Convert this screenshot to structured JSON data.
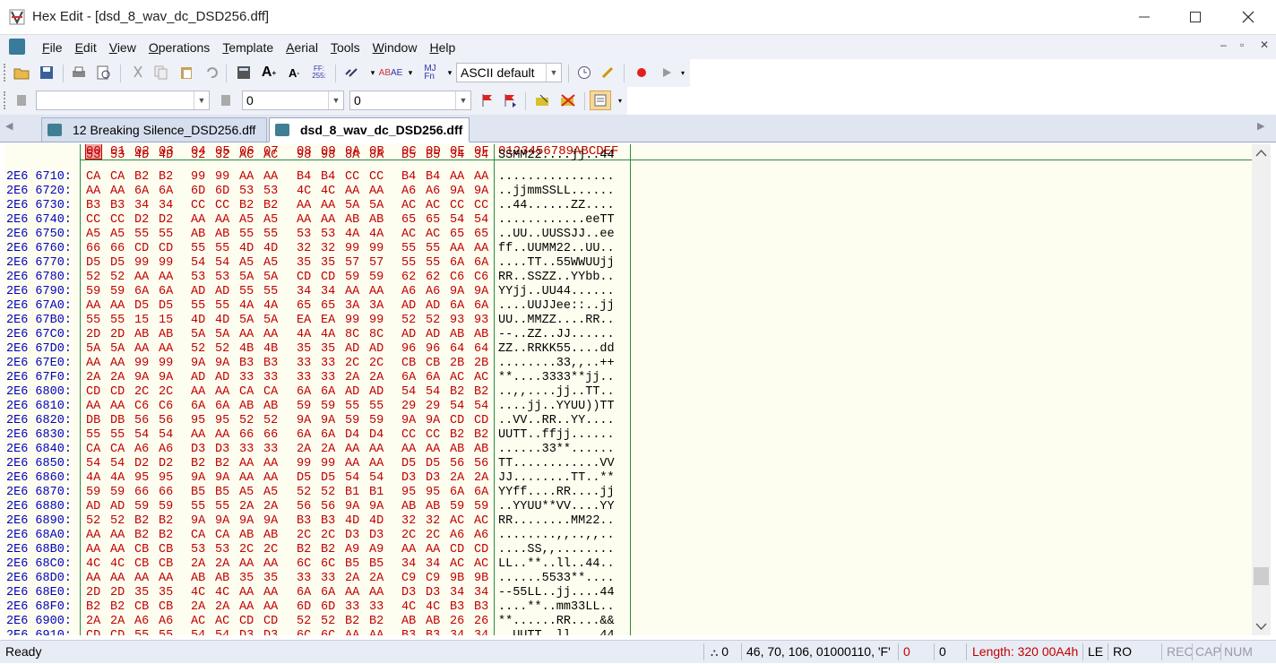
{
  "window": {
    "title": "Hex Edit - [dsd_8_wav_dc_DSD256.dff]"
  },
  "menu": [
    "File",
    "Edit",
    "View",
    "Operations",
    "Template",
    "Aerial",
    "Tools",
    "Window",
    "Help"
  ],
  "toolbar": {
    "charset_combo": "ASCII default"
  },
  "findbar": {
    "search_value": "",
    "field2": "0",
    "field3": "0"
  },
  "tabs": [
    {
      "label": "12 Breaking Silence_DSD256.dff",
      "active": false
    },
    {
      "label": "dsd_8_wav_dc_DSD256.dff",
      "active": true
    }
  ],
  "hex_header": {
    "columns": [
      "00",
      "01",
      "02",
      "03",
      "04",
      "05",
      "06",
      "07",
      "08",
      "09",
      "0A",
      "0B",
      "0C",
      "0D",
      "0E",
      "0F"
    ],
    "ascii_header": "0123456789ABCDEF"
  },
  "partial_top": {
    "hex": [
      "53",
      "53",
      "4D",
      "4D",
      "32",
      "32",
      "AC",
      "AC",
      "98",
      "98",
      "8A",
      "8A",
      "B5",
      "B5",
      "34",
      "34"
    ],
    "ascii": "SSMM22....jj..44"
  },
  "rows": [
    {
      "addr": "2E6 6710:",
      "hex": [
        "CA",
        "CA",
        "B2",
        "B2",
        "99",
        "99",
        "AA",
        "AA",
        "B4",
        "B4",
        "CC",
        "CC",
        "B4",
        "B4",
        "AA",
        "AA"
      ],
      "ascii": "................"
    },
    {
      "addr": "2E6 6720:",
      "hex": [
        "AA",
        "AA",
        "6A",
        "6A",
        "6D",
        "6D",
        "53",
        "53",
        "4C",
        "4C",
        "AA",
        "AA",
        "A6",
        "A6",
        "9A",
        "9A"
      ],
      "ascii": "..jjmmSSLL......"
    },
    {
      "addr": "2E6 6730:",
      "hex": [
        "B3",
        "B3",
        "34",
        "34",
        "CC",
        "CC",
        "B2",
        "B2",
        "AA",
        "AA",
        "5A",
        "5A",
        "AC",
        "AC",
        "CC",
        "CC"
      ],
      "ascii": "..44......ZZ...."
    },
    {
      "addr": "2E6 6740:",
      "hex": [
        "CC",
        "CC",
        "D2",
        "D2",
        "AA",
        "AA",
        "A5",
        "A5",
        "AA",
        "AA",
        "AB",
        "AB",
        "65",
        "65",
        "54",
        "54"
      ],
      "ascii": "............eeTT"
    },
    {
      "addr": "2E6 6750:",
      "hex": [
        "A5",
        "A5",
        "55",
        "55",
        "AB",
        "AB",
        "55",
        "55",
        "53",
        "53",
        "4A",
        "4A",
        "AC",
        "AC",
        "65",
        "65"
      ],
      "ascii": "..UU..UUSSJJ..ee"
    },
    {
      "addr": "2E6 6760:",
      "hex": [
        "66",
        "66",
        "CD",
        "CD",
        "55",
        "55",
        "4D",
        "4D",
        "32",
        "32",
        "99",
        "99",
        "55",
        "55",
        "AA",
        "AA"
      ],
      "ascii": "ff..UUMM22..UU.."
    },
    {
      "addr": "2E6 6770:",
      "hex": [
        "D5",
        "D5",
        "99",
        "99",
        "54",
        "54",
        "A5",
        "A5",
        "35",
        "35",
        "57",
        "57",
        "55",
        "55",
        "6A",
        "6A"
      ],
      "ascii": "....TT..55WWUUjj"
    },
    {
      "addr": "2E6 6780:",
      "hex": [
        "52",
        "52",
        "AA",
        "AA",
        "53",
        "53",
        "5A",
        "5A",
        "CD",
        "CD",
        "59",
        "59",
        "62",
        "62",
        "C6",
        "C6"
      ],
      "ascii": "RR..SSZZ..YYbb.."
    },
    {
      "addr": "2E6 6790:",
      "hex": [
        "59",
        "59",
        "6A",
        "6A",
        "AD",
        "AD",
        "55",
        "55",
        "34",
        "34",
        "AA",
        "AA",
        "A6",
        "A6",
        "9A",
        "9A"
      ],
      "ascii": "YYjj..UU44......"
    },
    {
      "addr": "2E6 67A0:",
      "hex": [
        "AA",
        "AA",
        "D5",
        "D5",
        "55",
        "55",
        "4A",
        "4A",
        "65",
        "65",
        "3A",
        "3A",
        "AD",
        "AD",
        "6A",
        "6A"
      ],
      "ascii": "....UUJJee::..jj"
    },
    {
      "addr": "2E6 67B0:",
      "hex": [
        "55",
        "55",
        "15",
        "15",
        "4D",
        "4D",
        "5A",
        "5A",
        "EA",
        "EA",
        "99",
        "99",
        "52",
        "52",
        "93",
        "93"
      ],
      "ascii": "UU..MMZZ....RR.."
    },
    {
      "addr": "2E6 67C0:",
      "hex": [
        "2D",
        "2D",
        "AB",
        "AB",
        "5A",
        "5A",
        "AA",
        "AA",
        "4A",
        "4A",
        "8C",
        "8C",
        "AD",
        "AD",
        "AB",
        "AB"
      ],
      "ascii": "--..ZZ..JJ......"
    },
    {
      "addr": "2E6 67D0:",
      "hex": [
        "5A",
        "5A",
        "AA",
        "AA",
        "52",
        "52",
        "4B",
        "4B",
        "35",
        "35",
        "AD",
        "AD",
        "96",
        "96",
        "64",
        "64"
      ],
      "ascii": "ZZ..RRKK55....dd"
    },
    {
      "addr": "2E6 67E0:",
      "hex": [
        "AA",
        "AA",
        "99",
        "99",
        "9A",
        "9A",
        "B3",
        "B3",
        "33",
        "33",
        "2C",
        "2C",
        "CB",
        "CB",
        "2B",
        "2B"
      ],
      "ascii": "........33,,..++"
    },
    {
      "addr": "2E6 67F0:",
      "hex": [
        "2A",
        "2A",
        "9A",
        "9A",
        "AD",
        "AD",
        "33",
        "33",
        "33",
        "33",
        "2A",
        "2A",
        "6A",
        "6A",
        "AC",
        "AC"
      ],
      "ascii": "**....3333**jj.."
    },
    {
      "addr": "2E6 6800:",
      "hex": [
        "CD",
        "CD",
        "2C",
        "2C",
        "AA",
        "AA",
        "CA",
        "CA",
        "6A",
        "6A",
        "AD",
        "AD",
        "54",
        "54",
        "B2",
        "B2"
      ],
      "ascii": "..,,....jj..TT.."
    },
    {
      "addr": "2E6 6810:",
      "hex": [
        "AA",
        "AA",
        "C6",
        "C6",
        "6A",
        "6A",
        "AB",
        "AB",
        "59",
        "59",
        "55",
        "55",
        "29",
        "29",
        "54",
        "54"
      ],
      "ascii": "....jj..YYUU))TT"
    },
    {
      "addr": "2E6 6820:",
      "hex": [
        "DB",
        "DB",
        "56",
        "56",
        "95",
        "95",
        "52",
        "52",
        "9A",
        "9A",
        "59",
        "59",
        "9A",
        "9A",
        "CD",
        "CD"
      ],
      "ascii": "..VV..RR..YY...."
    },
    {
      "addr": "2E6 6830:",
      "hex": [
        "55",
        "55",
        "54",
        "54",
        "AA",
        "AA",
        "66",
        "66",
        "6A",
        "6A",
        "D4",
        "D4",
        "CC",
        "CC",
        "B2",
        "B2"
      ],
      "ascii": "UUTT..ffjj......"
    },
    {
      "addr": "2E6 6840:",
      "hex": [
        "CA",
        "CA",
        "A6",
        "A6",
        "D3",
        "D3",
        "33",
        "33",
        "2A",
        "2A",
        "AA",
        "AA",
        "AA",
        "AA",
        "AB",
        "AB"
      ],
      "ascii": "......33**......"
    },
    {
      "addr": "2E6 6850:",
      "hex": [
        "54",
        "54",
        "D2",
        "D2",
        "B2",
        "B2",
        "AA",
        "AA",
        "99",
        "99",
        "AA",
        "AA",
        "D5",
        "D5",
        "56",
        "56"
      ],
      "ascii": "TT............VV"
    },
    {
      "addr": "2E6 6860:",
      "hex": [
        "4A",
        "4A",
        "95",
        "95",
        "9A",
        "9A",
        "AA",
        "AA",
        "D5",
        "D5",
        "54",
        "54",
        "D3",
        "D3",
        "2A",
        "2A"
      ],
      "ascii": "JJ........TT..**"
    },
    {
      "addr": "2E6 6870:",
      "hex": [
        "59",
        "59",
        "66",
        "66",
        "B5",
        "B5",
        "A5",
        "A5",
        "52",
        "52",
        "B1",
        "B1",
        "95",
        "95",
        "6A",
        "6A"
      ],
      "ascii": "YYff....RR....jj"
    },
    {
      "addr": "2E6 6880:",
      "hex": [
        "AD",
        "AD",
        "59",
        "59",
        "55",
        "55",
        "2A",
        "2A",
        "56",
        "56",
        "9A",
        "9A",
        "AB",
        "AB",
        "59",
        "59"
      ],
      "ascii": "..YYUU**VV....YY"
    },
    {
      "addr": "2E6 6890:",
      "hex": [
        "52",
        "52",
        "B2",
        "B2",
        "9A",
        "9A",
        "9A",
        "9A",
        "B3",
        "B3",
        "4D",
        "4D",
        "32",
        "32",
        "AC",
        "AC"
      ],
      "ascii": "RR........MM22.."
    },
    {
      "addr": "2E6 68A0:",
      "hex": [
        "AA",
        "AA",
        "B2",
        "B2",
        "CA",
        "CA",
        "AB",
        "AB",
        "2C",
        "2C",
        "D3",
        "D3",
        "2C",
        "2C",
        "A6",
        "A6"
      ],
      "ascii": "........,,..,,.."
    },
    {
      "addr": "2E6 68B0:",
      "hex": [
        "AA",
        "AA",
        "CB",
        "CB",
        "53",
        "53",
        "2C",
        "2C",
        "B2",
        "B2",
        "A9",
        "A9",
        "AA",
        "AA",
        "CD",
        "CD"
      ],
      "ascii": "....SS,,........"
    },
    {
      "addr": "2E6 68C0:",
      "hex": [
        "4C",
        "4C",
        "CB",
        "CB",
        "2A",
        "2A",
        "AA",
        "AA",
        "6C",
        "6C",
        "B5",
        "B5",
        "34",
        "34",
        "AC",
        "AC"
      ],
      "ascii": "LL..**..ll..44.."
    },
    {
      "addr": "2E6 68D0:",
      "hex": [
        "AA",
        "AA",
        "AA",
        "AA",
        "AB",
        "AB",
        "35",
        "35",
        "33",
        "33",
        "2A",
        "2A",
        "C9",
        "C9",
        "9B",
        "9B"
      ],
      "ascii": "......5533**...."
    },
    {
      "addr": "2E6 68E0:",
      "hex": [
        "2D",
        "2D",
        "35",
        "35",
        "4C",
        "4C",
        "AA",
        "AA",
        "6A",
        "6A",
        "AA",
        "AA",
        "D3",
        "D3",
        "34",
        "34"
      ],
      "ascii": "--55LL..jj....44"
    },
    {
      "addr": "2E6 68F0:",
      "hex": [
        "B2",
        "B2",
        "CB",
        "CB",
        "2A",
        "2A",
        "AA",
        "AA",
        "6D",
        "6D",
        "33",
        "33",
        "4C",
        "4C",
        "B3",
        "B3"
      ],
      "ascii": "....**..mm33LL.."
    },
    {
      "addr": "2E6 6900:",
      "hex": [
        "2A",
        "2A",
        "A6",
        "A6",
        "AC",
        "AC",
        "CD",
        "CD",
        "52",
        "52",
        "B2",
        "B2",
        "AB",
        "AB",
        "26",
        "26"
      ],
      "ascii": "**......RR....&&"
    },
    {
      "addr": "2E6 6910:",
      "hex": [
        "CD",
        "CD",
        "55",
        "55",
        "54",
        "54",
        "D3",
        "D3",
        "6C",
        "6C",
        "AA",
        "AA",
        "B3",
        "B3",
        "34",
        "34"
      ],
      "ascii": "..UUTT..ll....44"
    }
  ],
  "status": {
    "ready": "Ready",
    "sel_count": "0",
    "value_info": "46, 70, 106, 01000110, 'F'",
    "val1": "0",
    "val2": "0",
    "length": "Length: 320 00A4h",
    "endian": "LE",
    "ro": "RO",
    "rec": "REC",
    "cap": "CAP",
    "num": "NUM"
  },
  "colors": {
    "hex_text": "#c00000",
    "addr_text": "#0000c0",
    "editor_bg": "#fefef0",
    "guide_green": "#2e8b3a",
    "header_highlight": "#f4a0a0"
  }
}
